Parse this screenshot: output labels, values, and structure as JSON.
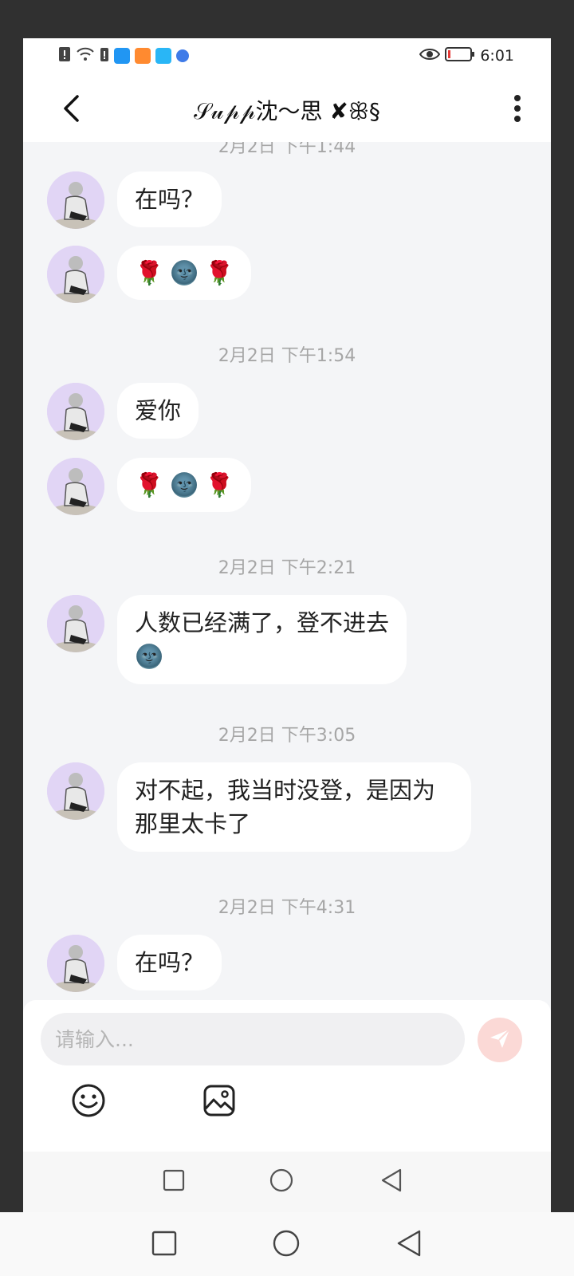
{
  "status_bar": {
    "time": "6:01",
    "left_icons": [
      "battery-alert-icon",
      "wifi-icon",
      "battery-alert-icon",
      "search-app-icon",
      "video-app-icon",
      "reader-app-icon",
      "browser-app-icon"
    ],
    "right_icons": [
      "eye-icon",
      "battery-low-icon"
    ]
  },
  "header": {
    "title": "𝒮𝓊𝓅𝓅沈～思 ✘ꕥ§",
    "back_icon": "chevron-left-icon",
    "more_icon": "more-vertical-icon"
  },
  "chat": {
    "partial_timestamp": "2月2日 下午1:44",
    "messages": [
      {
        "type": "text",
        "text": "在吗？"
      },
      {
        "type": "emoji",
        "emojis": [
          "🌹",
          "🌚",
          "🌹"
        ]
      },
      {
        "type": "timestamp",
        "text": "2月2日 下午1:54"
      },
      {
        "type": "text",
        "text": "爱你"
      },
      {
        "type": "emoji",
        "emojis": [
          "🌹",
          "🌚",
          "🌹"
        ]
      },
      {
        "type": "timestamp",
        "text": "2月2日 下午2:21"
      },
      {
        "type": "text",
        "text": "人数已经满了，登不进去"
      },
      {
        "type": "timestamp",
        "text": "2月2日 下午3:05"
      },
      {
        "type": "text",
        "text": "对不起，我当时没登，是因为那里太卡了"
      },
      {
        "type": "timestamp",
        "text": "2月2日 下午4:31"
      },
      {
        "type": "text",
        "text": "在吗？"
      }
    ]
  },
  "input": {
    "placeholder": "请输入...",
    "value": "",
    "send_icon": "send-icon",
    "tools": [
      "emoji-icon",
      "image-icon"
    ]
  },
  "colors": {
    "background": "#f4f5f7",
    "bubble": "#ffffff",
    "avatar": "#e1d5f5",
    "timestamp": "#a6a6a6",
    "send_button": "#fbd9d6",
    "frame": "#303030"
  }
}
